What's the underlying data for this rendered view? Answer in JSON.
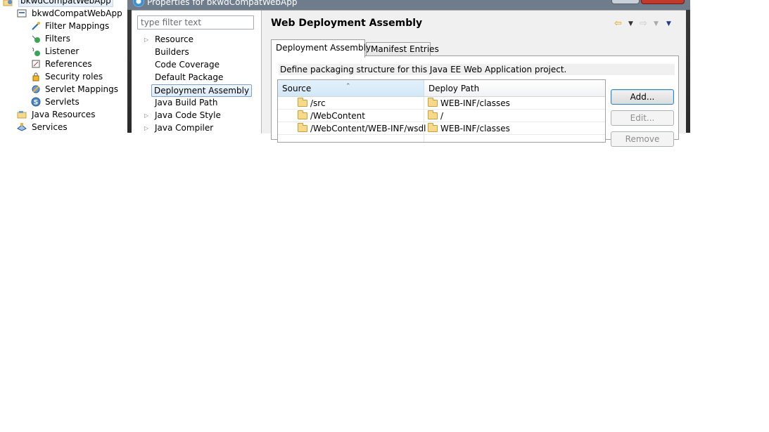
{
  "explorer": {
    "items": [
      {
        "label": "bkwdCompatWebApp",
        "icon": "web-project-icon"
      },
      {
        "label": "bkwdCompatWebApp",
        "icon": "deployment-descriptor-icon"
      },
      {
        "label": "Filter Mappings",
        "icon": "filter-mapping-icon"
      },
      {
        "label": "Filters",
        "icon": "filter-icon"
      },
      {
        "label": "Listener",
        "icon": "listener-icon"
      },
      {
        "label": "References",
        "icon": "references-icon"
      },
      {
        "label": "Security roles",
        "icon": "security-roles-icon"
      },
      {
        "label": "Servlet Mappings",
        "icon": "servlet-mapping-icon"
      },
      {
        "label": "Servlets",
        "icon": "servlet-icon"
      },
      {
        "label": "Java Resources",
        "icon": "java-resources-icon"
      },
      {
        "label": "Services",
        "icon": "services-icon"
      }
    ]
  },
  "dialog": {
    "title": "Properties for bkwdCompatWebApp",
    "filter": {
      "placeholder": "type filter text",
      "value": ""
    },
    "nav": [
      {
        "label": "Resource",
        "expandable": true
      },
      {
        "label": "Builders",
        "expandable": false
      },
      {
        "label": "Code Coverage",
        "expandable": false
      },
      {
        "label": "Default Package",
        "expandable": false
      },
      {
        "label": "Deployment Assembly",
        "expandable": false,
        "selected": true
      },
      {
        "label": "Java Build Path",
        "expandable": false
      },
      {
        "label": "Java Code Style",
        "expandable": true
      },
      {
        "label": "Java Compiler",
        "expandable": true
      }
    ],
    "page_title": "Web Deployment Assembly",
    "tabs": [
      {
        "label": "Deployment Assembly",
        "active": true
      },
      {
        "label": "Manifest Entries",
        "active": false
      }
    ],
    "description": "Define packaging structure for this Java EE Web Application project.",
    "table": {
      "columns": [
        "Source",
        "Deploy Path"
      ],
      "rows": [
        {
          "source": "/src",
          "deploy": "WEB-INF/classes"
        },
        {
          "source": "/WebContent",
          "deploy": "/"
        },
        {
          "source": "/WebContent/WEB-INF/wsdl",
          "deploy": "WEB-INF/classes"
        }
      ]
    },
    "buttons": {
      "add": "Add...",
      "edit": "Edit...",
      "remove": "Remove"
    }
  }
}
